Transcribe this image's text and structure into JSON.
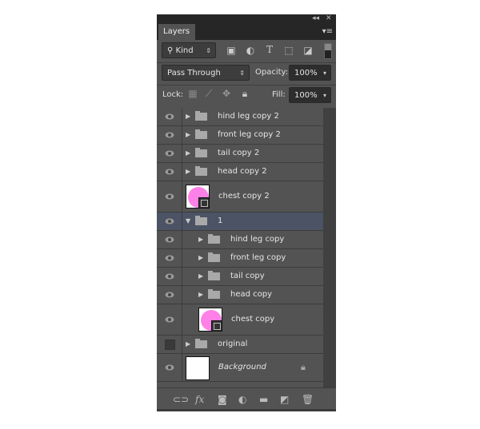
{
  "panel": {
    "title_buttons": {
      "collapse": "◂◂",
      "close": "✕"
    },
    "tab": "Layers",
    "menu_icon": "panel-menu-icon"
  },
  "filter": {
    "kind_label": "Kind",
    "icons": [
      "image-filter-icon",
      "adjustment-filter-icon",
      "type-filter-icon",
      "shape-filter-icon",
      "smart-object-filter-icon"
    ],
    "type_glyph": "T"
  },
  "blend": {
    "mode": "Pass Through",
    "opacity_label": "Opacity:",
    "opacity": "100%"
  },
  "lock": {
    "label": "Lock:",
    "fill_label": "Fill:",
    "fill": "100%"
  },
  "layers": [
    {
      "name": "hind leg copy 2",
      "type": "group",
      "visible": true
    },
    {
      "name": "front leg copy 2",
      "type": "group",
      "visible": true
    },
    {
      "name": "tail copy 2",
      "type": "group",
      "visible": true
    },
    {
      "name": "head copy 2",
      "type": "group",
      "visible": true
    },
    {
      "name": "chest copy 2",
      "type": "shape",
      "visible": true
    },
    {
      "name": "1",
      "type": "group",
      "visible": true,
      "expanded": true,
      "selected": true
    },
    {
      "name": "hind leg copy",
      "type": "group",
      "visible": true
    },
    {
      "name": "front leg copy",
      "type": "group",
      "visible": true
    },
    {
      "name": "tail copy",
      "type": "group",
      "visible": true
    },
    {
      "name": "head copy",
      "type": "group",
      "visible": true
    },
    {
      "name": "chest copy",
      "type": "shape",
      "visible": true
    },
    {
      "name": "original",
      "type": "group",
      "visible": false
    },
    {
      "name": "Background",
      "type": "background",
      "visible": true,
      "locked": true
    }
  ],
  "colors": {
    "selected_row": "#4b5365",
    "shape_fill": "#ff80e6",
    "panel": "#535353"
  },
  "footer": {
    "fx_label": "fx",
    "icons": [
      "link-layers-icon",
      "fx-icon",
      "add-mask-icon",
      "adjustment-layer-icon",
      "new-group-icon",
      "new-layer-icon",
      "delete-icon"
    ]
  }
}
